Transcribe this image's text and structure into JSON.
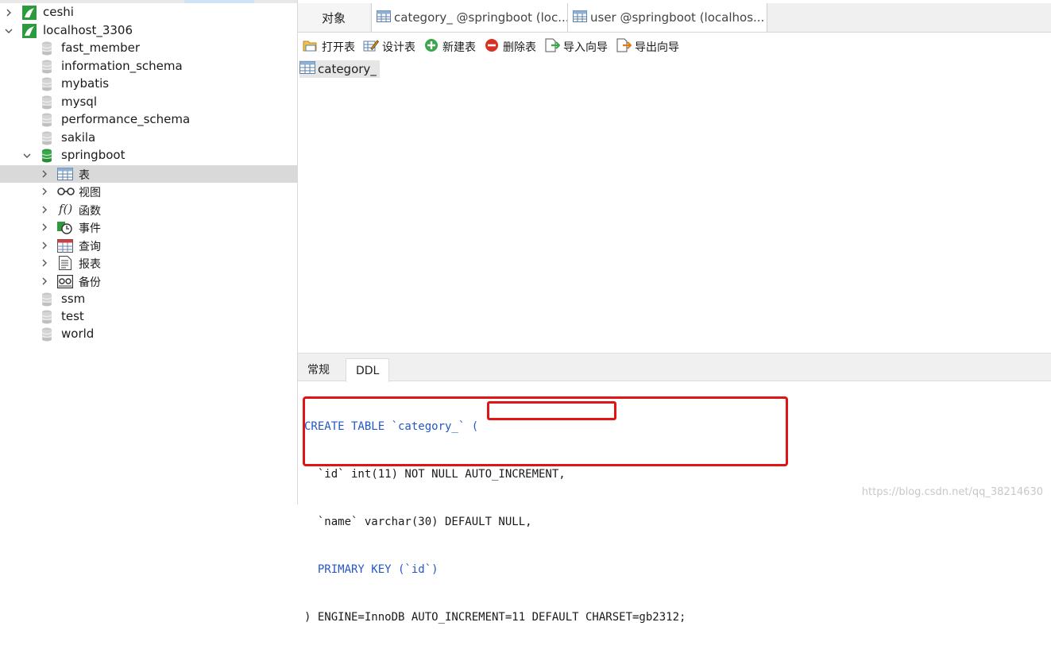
{
  "tree": {
    "connections": [
      {
        "label": "ceshi",
        "expanded": false
      },
      {
        "label": "localhost_3306",
        "expanded": true
      }
    ],
    "databases": [
      {
        "label": "fast_member"
      },
      {
        "label": "information_schema"
      },
      {
        "label": "mybatis"
      },
      {
        "label": "mysql"
      },
      {
        "label": "performance_schema"
      },
      {
        "label": "sakila"
      },
      {
        "label": "springboot",
        "expanded": true
      },
      {
        "label": "ssm"
      },
      {
        "label": "test"
      },
      {
        "label": "world"
      }
    ],
    "springboot_children": [
      {
        "label": "表",
        "icon": "table-icon"
      },
      {
        "label": "视图",
        "icon": "view-glasses-icon"
      },
      {
        "label": "函数",
        "icon": "function-icon"
      },
      {
        "label": "事件",
        "icon": "event-clock-icon"
      },
      {
        "label": "查询",
        "icon": "query-icon"
      },
      {
        "label": "报表",
        "icon": "report-icon"
      },
      {
        "label": "备份",
        "icon": "backup-icon"
      }
    ]
  },
  "tabs": {
    "objects": "对象",
    "tab1": "category_ @springboot (loc...",
    "tab2": "user @springboot (localhos..."
  },
  "toolbar": {
    "open": "打开表",
    "design": "设计表",
    "new": "新建表",
    "delete": "删除表",
    "import": "导入向导",
    "export": "导出向导"
  },
  "objects": {
    "items": [
      "category_"
    ]
  },
  "bottom_tabs": {
    "general": "常规",
    "ddl": "DDL"
  },
  "ddl": {
    "line1": "CREATE TABLE `category_` (",
    "line2": "  `id` int(11) NOT NULL AUTO_INCREMENT,",
    "line3": "  `name` varchar(30) DEFAULT NULL,",
    "line4": "  PRIMARY KEY (`id`)",
    "line5": ") ENGINE=InnoDB AUTO_INCREMENT=11 DEFAULT CHARSET=gb2312;"
  },
  "watermark": "https://blog.csdn.net/qq_38214630",
  "colors": {
    "highlight_box": "#e01414",
    "keyword": "#2457c6",
    "number": "#0a8a3a",
    "connection_green": "#2e9a3e"
  }
}
